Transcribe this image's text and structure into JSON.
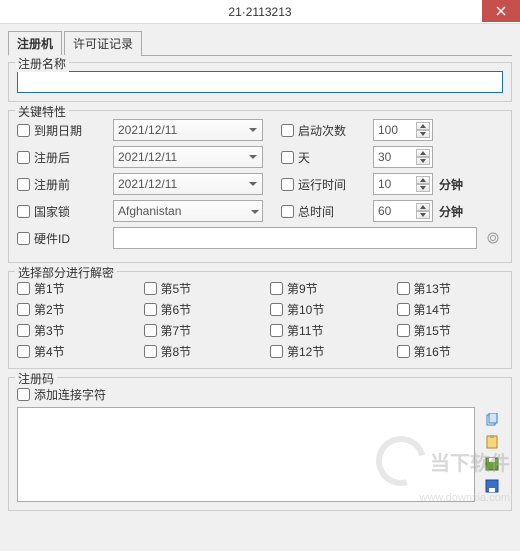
{
  "window": {
    "title": "21·2113213"
  },
  "tabs": {
    "register": "注册机",
    "license_log": "许可证记录"
  },
  "groups": {
    "reg_name": "注册名称",
    "key_props": "关键特性",
    "sections": "选择部分进行解密",
    "reg_code": "注册码"
  },
  "key_props": {
    "expire_date": {
      "label": "到期日期",
      "value": "2021/12/11"
    },
    "after_reg": {
      "label": "注册后",
      "value": "2021/12/11"
    },
    "before_reg": {
      "label": "注册前",
      "value": "2021/12/11"
    },
    "country_lock": {
      "label": "国家锁",
      "value": "Afghanistan"
    },
    "hardware_id": {
      "label": "硬件ID",
      "value": ""
    },
    "launch_count": {
      "label": "启动次数",
      "value": "100"
    },
    "days": {
      "label": "天",
      "value": "30"
    },
    "run_time": {
      "label": "运行时间",
      "value": "10",
      "unit": "分钟"
    },
    "total_time": {
      "label": "总时间",
      "value": "60",
      "unit": "分钟"
    }
  },
  "sections": [
    "第1节",
    "第2节",
    "第3节",
    "第4节",
    "第5节",
    "第6节",
    "第7节",
    "第8节",
    "第9节",
    "第10节",
    "第11节",
    "第12节",
    "第13节",
    "第14节",
    "第15节",
    "第16节"
  ],
  "reg_code": {
    "append_sep": "添加连接字符"
  },
  "watermark": {
    "brand": "当下软件",
    "url": "www.downxia.com"
  }
}
